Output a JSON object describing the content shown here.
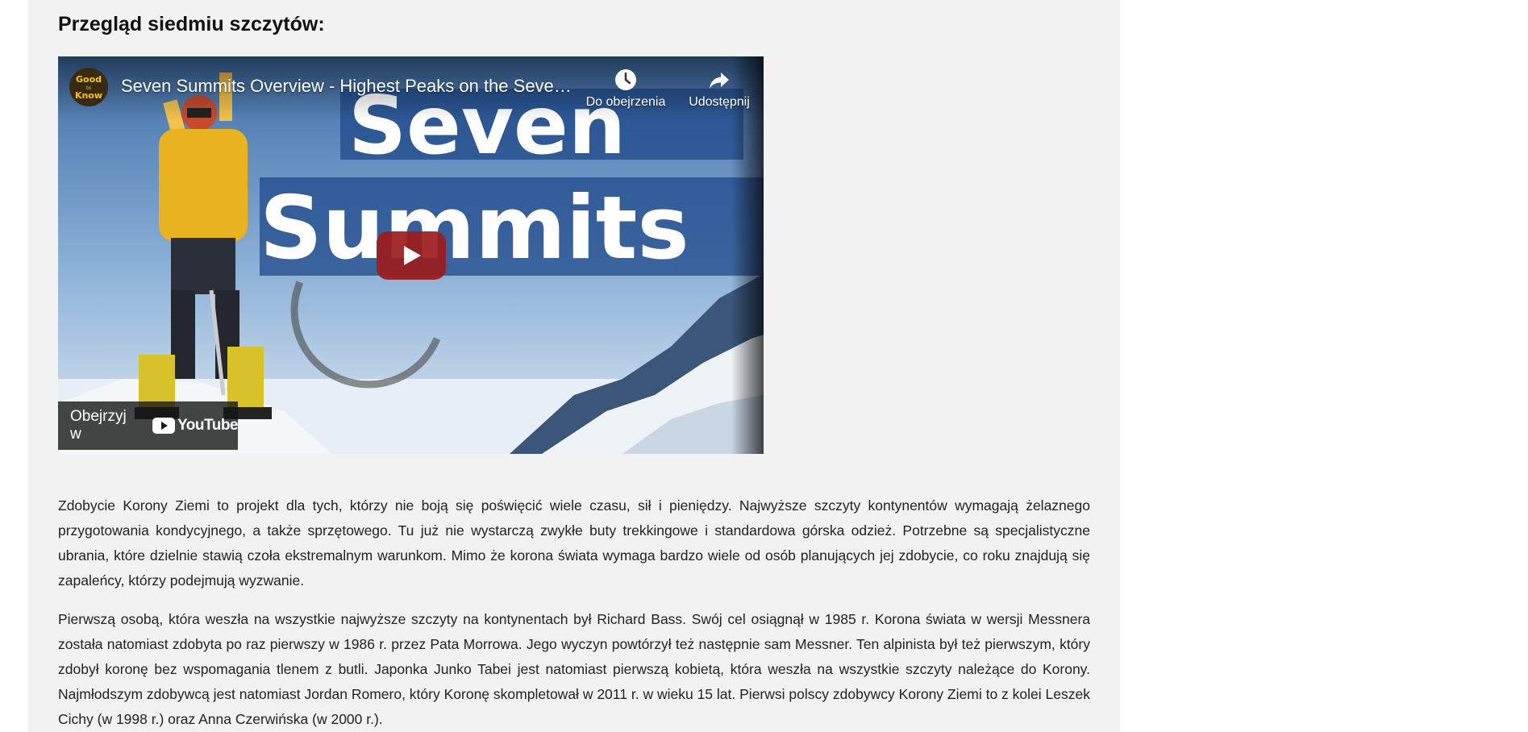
{
  "section": {
    "title": "Przegląd siedmiu szczytów:"
  },
  "video": {
    "title": "Seven Summits Overview - Highest Peaks on the Seven Continents",
    "channel_logo_text": [
      "Good",
      "to",
      "Know"
    ],
    "thumbnail_text": [
      "Seven",
      "Summits"
    ],
    "actions": {
      "watch_later": "Do obejrzenia",
      "share": "Udostępnij"
    },
    "watch_on_label": "Obejrzyj w",
    "youtube_word": "YouTube"
  },
  "article": {
    "paragraphs": [
      "Zdobycie Korony Ziemi to projekt dla tych, którzy nie boją się poświęcić wiele czasu, sił i pieniędzy. Najwyższe szczyty kontynentów wymagają żelaznego przygotowania kondycyjnego, a także sprzętowego. Tu już nie wystarczą zwykłe buty trekkingowe i standardowa górska odzież. Potrzebne są specjalistyczne ubrania, które dzielnie stawią czoła ekstremalnym warunkom. Mimo że korona świata wymaga bardzo wiele od osób planujących jej zdobycie, co roku znajdują się zapaleńcy, którzy podejmują wyzwanie.",
      "Pierwszą osobą, która weszła na wszystkie najwyższe szczyty na kontynentach był Richard Bass. Swój cel osiągnął w 1985 r. Korona świata w wersji Messnera została natomiast zdobyta po raz pierwszy w 1986 r. przez Pata Morrowa. Jego wyczyn powtórzył też następnie sam Messner. Ten alpinista był też pierwszym, który zdobył koronę bez wspomagania tlenem z butli. Japonka Junko Tabei jest natomiast pierwszą kobietą, która weszła na wszystkie szczyty należące do Korony. Najmłodszym zdobywcą jest natomiast Jordan Romero, który Koronę skompletował w 2011 r. w wieku 15 lat. Pierwsi polscy zdobywcy Korony Ziemi to z kolei Leszek Cichy (w 1998 r.) oraz Anna Czerwińska (w 2000 r.)."
    ]
  },
  "colors": {
    "page_column_bg": "#f2f2f2",
    "youtube_red": "#ff0000",
    "play_button_bg": "#9b1c1c",
    "text": "#222222"
  },
  "icons": {
    "watch_later": "clock-icon",
    "share": "share-arrow-icon",
    "play": "play-icon",
    "youtube": "youtube-logo-icon"
  }
}
